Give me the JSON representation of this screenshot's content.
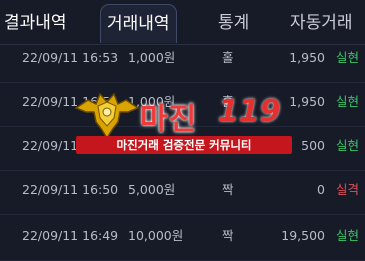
{
  "tabs": [
    {
      "label": "결과내역"
    },
    {
      "label": "거래내역"
    },
    {
      "label": "통계"
    },
    {
      "label": "자동거래"
    }
  ],
  "rows": [
    {
      "time": "22/09/11 16:53",
      "amount": "1,000원",
      "bet": "홀",
      "payout": "1,950",
      "result": "실현"
    },
    {
      "time": "22/09/11 16:52",
      "amount": "1,000원",
      "bet": "홀",
      "payout": "1,950",
      "result": "실현"
    },
    {
      "time": "22/09/11 16:51",
      "amount": "",
      "bet": "",
      "payout": "500",
      "result": "실현"
    },
    {
      "time": "22/09/11 16:50",
      "amount": "5,000원",
      "bet": "짝",
      "payout": "0",
      "result": "실격"
    },
    {
      "time": "22/09/11 16:49",
      "amount": "10,000원",
      "bet": "짝",
      "payout": "19,500",
      "result": "실현"
    }
  ],
  "watermark": {
    "title": "마진",
    "number": "119",
    "banner": "마진거래 검증전문 커뮤니티"
  },
  "colors": {
    "background": "#171b27",
    "success": "#3cc46a",
    "fail": "#e0515a",
    "watermark_red": "#c4161c"
  }
}
